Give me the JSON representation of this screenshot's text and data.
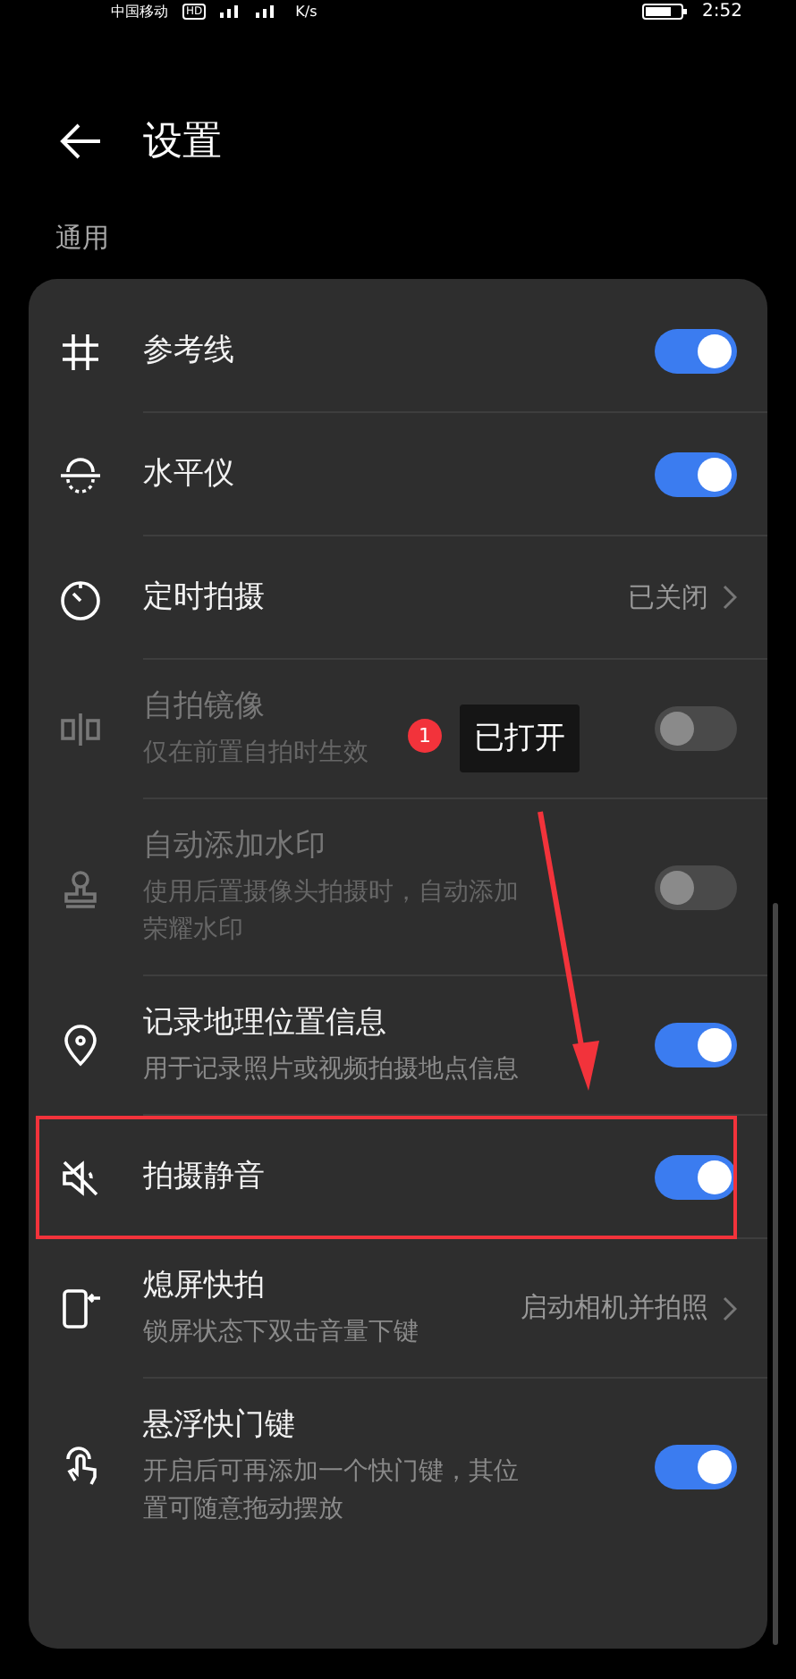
{
  "status_bar": {
    "carrier": "中国移动",
    "hd_badge": "HD",
    "speed": "K/s",
    "time": "2:52"
  },
  "header": {
    "title": "设置"
  },
  "section_title": "通用",
  "rows": [
    {
      "kind": "toggle",
      "label": "参考线",
      "on": true,
      "disabled": false,
      "highlighted": false
    },
    {
      "kind": "toggle",
      "label": "水平仪",
      "on": true,
      "disabled": false,
      "highlighted": false
    },
    {
      "kind": "link",
      "label": "定时拍摄",
      "value": "已关闭",
      "disabled": false,
      "highlighted": false
    },
    {
      "kind": "toggle",
      "label": "自拍镜像",
      "description": "仅在前置自拍时生效",
      "on": false,
      "disabled": true,
      "highlighted": false
    },
    {
      "kind": "toggle",
      "label": "自动添加水印",
      "description": "使用后置摄像头拍摄时，自动添加荣耀水印",
      "on": false,
      "disabled": true,
      "highlighted": false
    },
    {
      "kind": "toggle",
      "label": "记录地理位置信息",
      "description": "用于记录照片或视频拍摄地点信息",
      "on": true,
      "disabled": false,
      "highlighted": false
    },
    {
      "kind": "toggle",
      "label": "拍摄静音",
      "on": true,
      "disabled": false,
      "highlighted": true
    },
    {
      "kind": "link",
      "label": "熄屏快拍",
      "description": "锁屏状态下双击音量下键",
      "value": "启动相机并拍照",
      "disabled": false,
      "highlighted": false
    },
    {
      "kind": "toggle",
      "label": "悬浮快门键",
      "description": "开启后可再添加一个快门键，其位置可随意拖动摆放",
      "on": true,
      "disabled": false,
      "highlighted": false
    }
  ],
  "annotation": {
    "badge": "1",
    "callout": "已打开"
  }
}
